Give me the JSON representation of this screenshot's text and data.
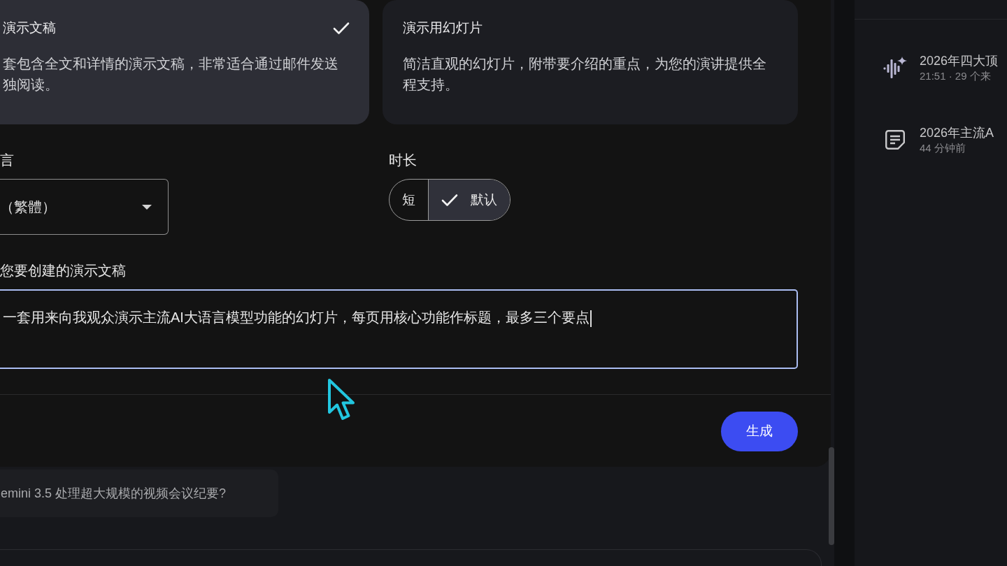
{
  "format_options": [
    {
      "title": "演示文稿",
      "description": [
        "套包含全文和详情的演示文稿，非常适合通过邮件发送",
        "独阅读。"
      ],
      "selected": true
    },
    {
      "title": "演示用幻灯片",
      "description": [
        "简洁直观的幻灯片，附带要介绍的重点，为您的演讲提供全程支持。"
      ],
      "selected": false
    }
  ],
  "language": {
    "label": "言",
    "value": "（繁體）"
  },
  "duration": {
    "label": "时长",
    "options": [
      {
        "label": "短",
        "selected": false
      },
      {
        "label": "默认",
        "selected": true
      }
    ]
  },
  "prompt": {
    "label": "您要创建的演示文稿",
    "value": "一套用来向我观众演示主流AI大语言模型功能的幻灯片，每页用核心功能作标题，最多三个要点"
  },
  "generate_button": "生成",
  "suggestion": "emini 3.5 处理超大规模的视频会议纪要?",
  "studio_items": [
    {
      "kind": "audio",
      "title": "2026年四大顶",
      "meta": "21:51 · 29 个来"
    },
    {
      "kind": "note",
      "title": "2026年主流A",
      "meta": "44 分钟前"
    }
  ]
}
